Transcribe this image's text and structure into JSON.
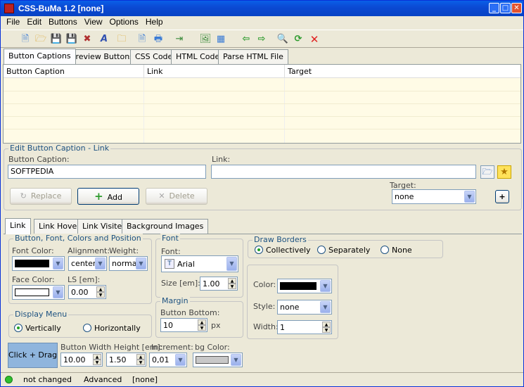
{
  "window": {
    "title": "CSS-BuMa 1.2  [none]"
  },
  "menu": [
    "File",
    "Edit",
    "Buttons",
    "View",
    "Options",
    "Help"
  ],
  "top_tabs": [
    "Button Captions",
    "Preview Buttons",
    "CSS Code",
    "HTML Code",
    "Parse HTML File"
  ],
  "grid": {
    "columns": [
      "Button Caption",
      "Link",
      "Target"
    ]
  },
  "edit": {
    "legend": "Edit Button Caption - Link",
    "caption_label": "Button Caption:",
    "caption_value": "SOFTPEDIA",
    "link_label": "Link:",
    "link_value": "",
    "target_label": "Target:",
    "target_value": "none",
    "replace": "Replace",
    "add": "Add",
    "delete": "Delete",
    "plus": "+"
  },
  "style_tabs": [
    "Link",
    "Link Hover",
    "Link Visited",
    "Background Images"
  ],
  "bfc": {
    "legend": "Button,  Font, Colors and Position",
    "font_color_label": "Font Color:",
    "alignment_label": "Alignment:",
    "alignment_value": "center",
    "weight_label": "Weight:",
    "weight_value": "normal",
    "face_color_label": "Face Color:",
    "ls_label": "LS [em]:",
    "ls_value": "0.00"
  },
  "font": {
    "legend": "Font",
    "font_label": "Font:",
    "font_value": "Arial",
    "size_label": "Size [em]:",
    "size_value": "1.00"
  },
  "margin": {
    "legend": "Margin",
    "bottom_label": "Button Bottom:",
    "bottom_value": "10",
    "unit": "px"
  },
  "display": {
    "legend": "Display Menu",
    "vertically": "Vertically",
    "horizontally": "Horizontally"
  },
  "borders": {
    "legend": "Draw Borders",
    "collectively": "Collectively",
    "separately": "Separately",
    "none": "None",
    "color_label": "Color:",
    "style_label": "Style:",
    "style_value": "none",
    "width_label": "Width:",
    "width_value": "1"
  },
  "bottom": {
    "preview_label": "Click + Drag",
    "wh_label": "Button Width Height [em]:",
    "width_value": "10.00",
    "height_value": "1.50",
    "increment_label": "Increment:",
    "increment_value": "0,01",
    "bg_label": "bg Color:"
  },
  "status": {
    "state": "not changed",
    "mode": "Advanced",
    "file": "[none]"
  },
  "colors": {
    "titlebar": "#0b4ad4",
    "accent_text": "#1c5180",
    "grid_bg": "#fffbe6",
    "preview_bg": "#8fb5dd"
  }
}
